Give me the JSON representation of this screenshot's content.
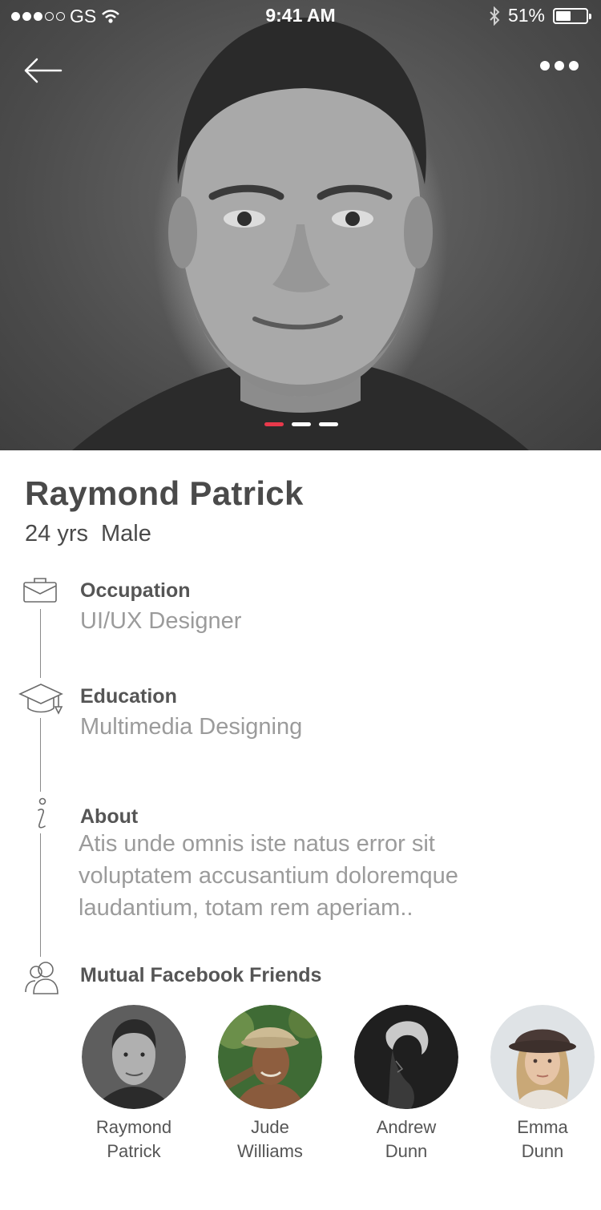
{
  "status_bar": {
    "carrier": "GS",
    "time": "9:41 AM",
    "battery": "51%",
    "battery_level": 0.51,
    "signal_bars_filled": 3,
    "signal_bars_total": 5
  },
  "header": {
    "back_icon": "arrow-left-icon",
    "more_icon": "more-dots-icon"
  },
  "photo_carousel": {
    "total_pages": 3,
    "active_page": 1,
    "active_color": "#e8394b"
  },
  "profile": {
    "name": "Raymond Patrick",
    "age": "24 yrs",
    "gender": "Male"
  },
  "sections": {
    "occupation": {
      "title": "Occupation",
      "value": "UI/UX Designer",
      "icon": "briefcase-icon"
    },
    "education": {
      "title": "Education",
      "value": "Multimedia Designing",
      "icon": "graduation-cap-icon"
    },
    "about": {
      "title": "About",
      "value": "Atis unde omnis iste natus error sit voluptatem accusantium doloremque laudantium, totam rem aperiam..",
      "icon": "info-icon"
    },
    "friends": {
      "title": "Mutual Facebook Friends",
      "icon": "users-icon"
    }
  },
  "friends": [
    {
      "first": "Raymond",
      "last": "Patrick"
    },
    {
      "first": "Jude",
      "last": "Williams"
    },
    {
      "first": "Andrew",
      "last": "Dunn"
    },
    {
      "first": "Emma",
      "last": "Dunn"
    }
  ],
  "colors": {
    "accent": "#e8394b",
    "text_primary": "#4a4a4a",
    "text_secondary": "#9b9b9b"
  }
}
